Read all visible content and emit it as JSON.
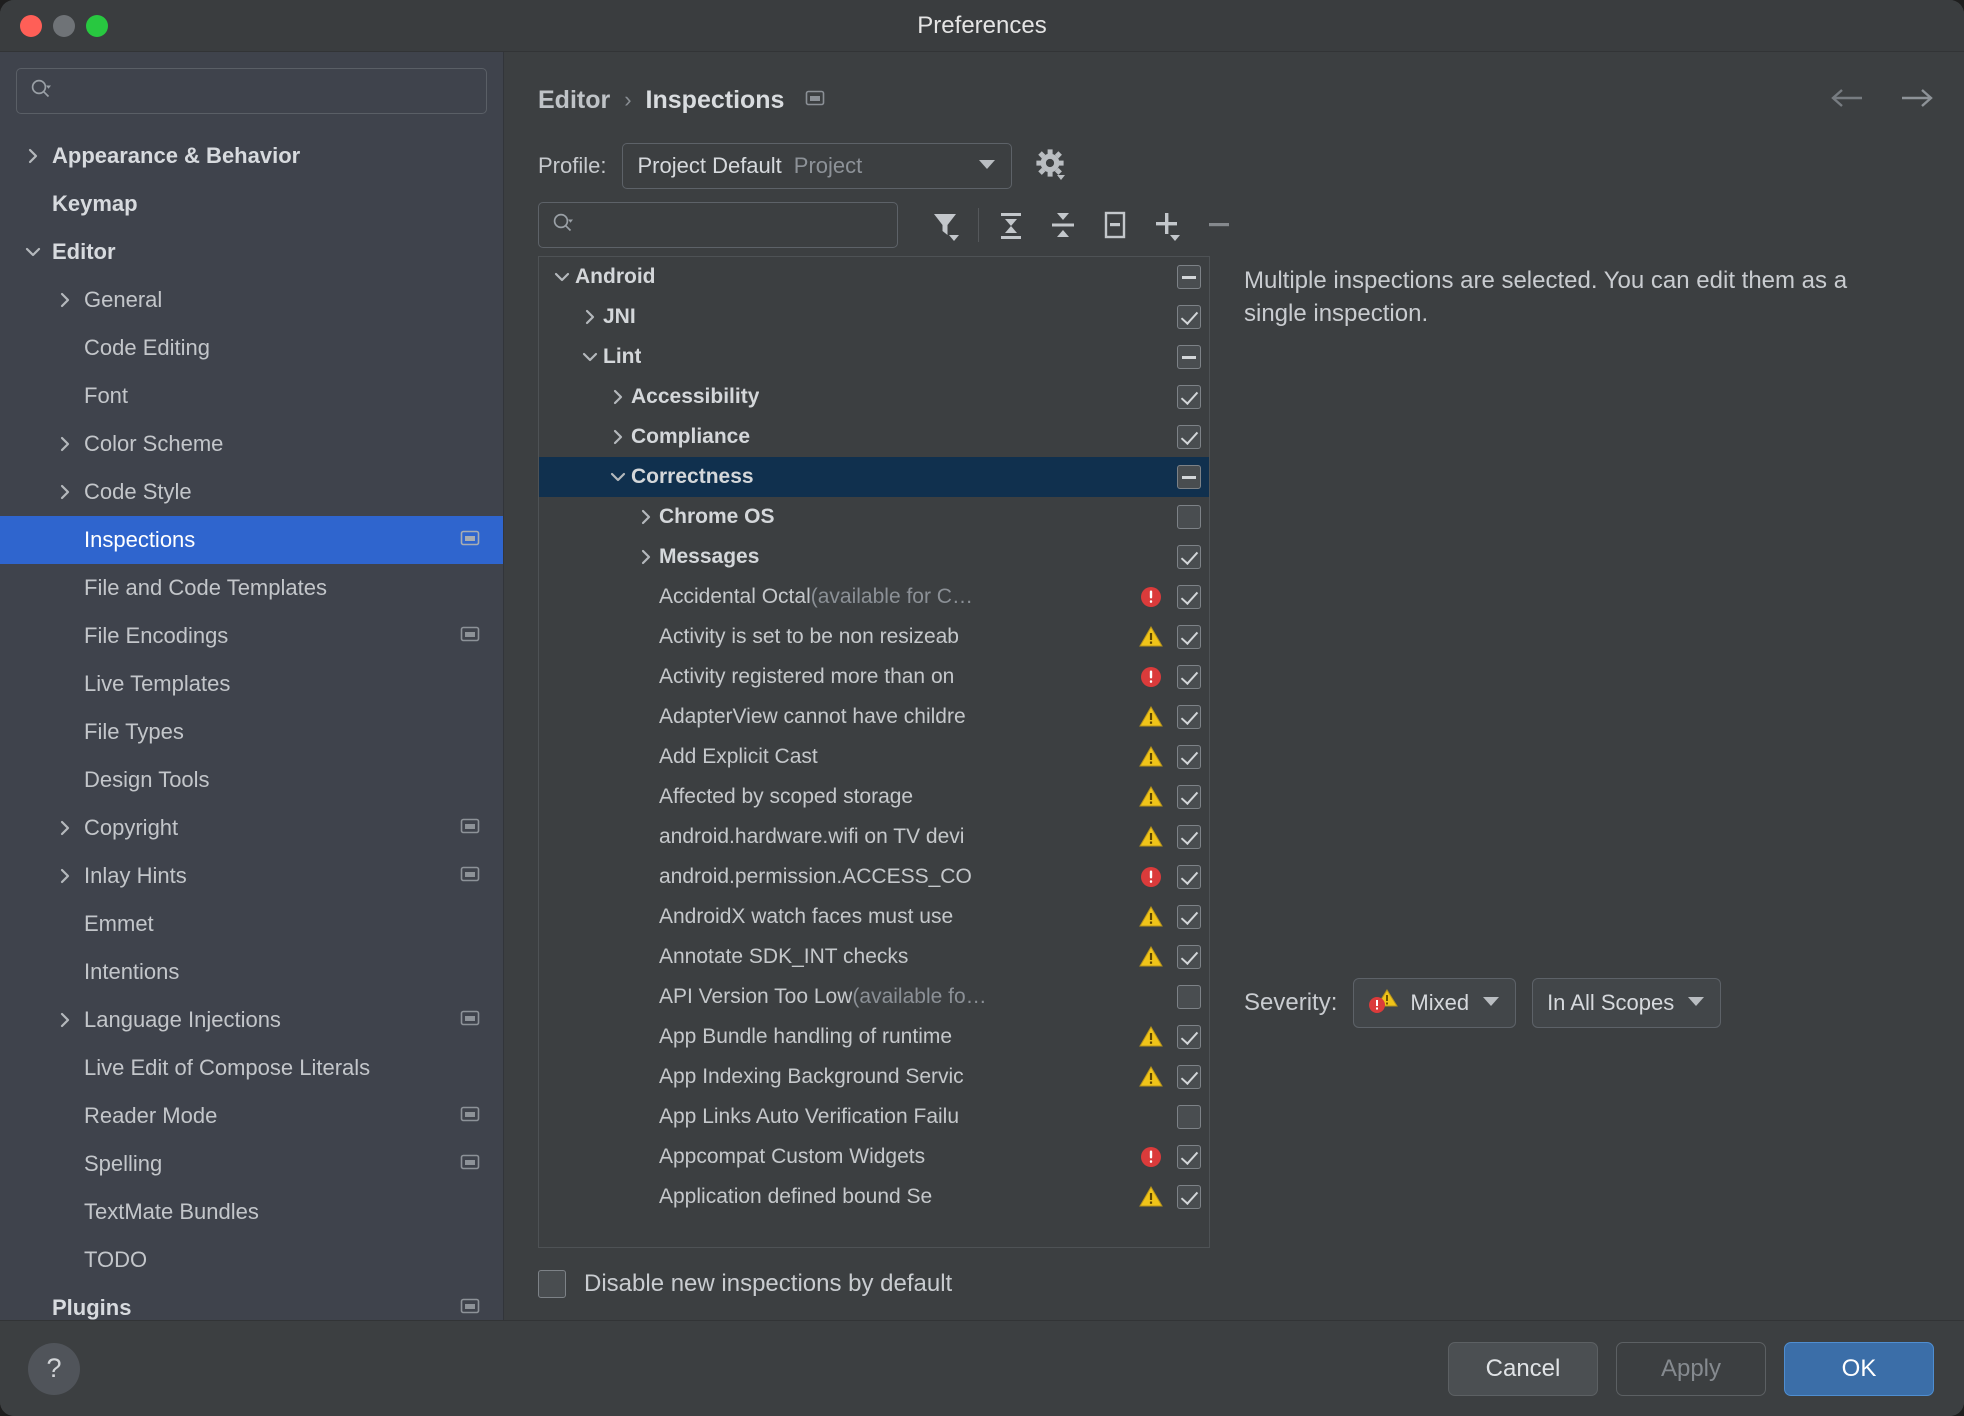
{
  "window": {
    "title": "Preferences"
  },
  "sidebar": {
    "search_placeholder": "",
    "search_value": "",
    "items": [
      {
        "label": "Appearance & Behavior",
        "arrow": "collapsed",
        "bold": true,
        "indent": 0,
        "badge": false,
        "selected": false
      },
      {
        "label": "Keymap",
        "arrow": "none",
        "bold": true,
        "indent": 0,
        "badge": false,
        "selected": false
      },
      {
        "label": "Editor",
        "arrow": "expanded",
        "bold": true,
        "indent": 0,
        "badge": false,
        "selected": false
      },
      {
        "label": "General",
        "arrow": "collapsed",
        "bold": false,
        "indent": 1,
        "badge": false,
        "selected": false
      },
      {
        "label": "Code Editing",
        "arrow": "none",
        "bold": false,
        "indent": 1,
        "badge": false,
        "selected": false
      },
      {
        "label": "Font",
        "arrow": "none",
        "bold": false,
        "indent": 1,
        "badge": false,
        "selected": false
      },
      {
        "label": "Color Scheme",
        "arrow": "collapsed",
        "bold": false,
        "indent": 1,
        "badge": false,
        "selected": false
      },
      {
        "label": "Code Style",
        "arrow": "collapsed",
        "bold": false,
        "indent": 1,
        "badge": false,
        "selected": false
      },
      {
        "label": "Inspections",
        "arrow": "none",
        "bold": false,
        "indent": 1,
        "badge": true,
        "selected": true
      },
      {
        "label": "File and Code Templates",
        "arrow": "none",
        "bold": false,
        "indent": 1,
        "badge": false,
        "selected": false
      },
      {
        "label": "File Encodings",
        "arrow": "none",
        "bold": false,
        "indent": 1,
        "badge": true,
        "selected": false
      },
      {
        "label": "Live Templates",
        "arrow": "none",
        "bold": false,
        "indent": 1,
        "badge": false,
        "selected": false
      },
      {
        "label": "File Types",
        "arrow": "none",
        "bold": false,
        "indent": 1,
        "badge": false,
        "selected": false
      },
      {
        "label": "Design Tools",
        "arrow": "none",
        "bold": false,
        "indent": 1,
        "badge": false,
        "selected": false
      },
      {
        "label": "Copyright",
        "arrow": "collapsed",
        "bold": false,
        "indent": 1,
        "badge": true,
        "selected": false
      },
      {
        "label": "Inlay Hints",
        "arrow": "collapsed",
        "bold": false,
        "indent": 1,
        "badge": true,
        "selected": false
      },
      {
        "label": "Emmet",
        "arrow": "none",
        "bold": false,
        "indent": 1,
        "badge": false,
        "selected": false
      },
      {
        "label": "Intentions",
        "arrow": "none",
        "bold": false,
        "indent": 1,
        "badge": false,
        "selected": false
      },
      {
        "label": "Language Injections",
        "arrow": "collapsed",
        "bold": false,
        "indent": 1,
        "badge": true,
        "selected": false
      },
      {
        "label": "Live Edit of Compose Literals",
        "arrow": "none",
        "bold": false,
        "indent": 1,
        "badge": false,
        "selected": false
      },
      {
        "label": "Reader Mode",
        "arrow": "none",
        "bold": false,
        "indent": 1,
        "badge": true,
        "selected": false
      },
      {
        "label": "Spelling",
        "arrow": "none",
        "bold": false,
        "indent": 1,
        "badge": true,
        "selected": false
      },
      {
        "label": "TextMate Bundles",
        "arrow": "none",
        "bold": false,
        "indent": 1,
        "badge": false,
        "selected": false
      },
      {
        "label": "TODO",
        "arrow": "none",
        "bold": false,
        "indent": 1,
        "badge": false,
        "selected": false
      },
      {
        "label": "Plugins",
        "arrow": "none",
        "bold": true,
        "indent": 0,
        "badge": true,
        "selected": false
      }
    ]
  },
  "breadcrumb": {
    "root": "Editor",
    "separator": "›",
    "current": "Inspections"
  },
  "profile": {
    "label": "Profile:",
    "selected": "Project Default",
    "scope": "Project",
    "gear_icon": "gear-icon"
  },
  "toolbar": {
    "search_value": "",
    "search_placeholder": "",
    "buttons": [
      {
        "name": "filter-icon",
        "title": "Filter"
      },
      {
        "name": "expand-all-icon",
        "title": "Expand All"
      },
      {
        "name": "collapse-all-icon",
        "title": "Collapse All"
      },
      {
        "name": "reset-icon",
        "title": "Reset"
      },
      {
        "name": "add-icon",
        "title": "Add"
      },
      {
        "name": "remove-icon",
        "title": "Remove"
      }
    ]
  },
  "inspection_tree": {
    "rows": [
      {
        "label": "Android",
        "suffix": "",
        "indent": 0,
        "twisty": "expanded",
        "group": true,
        "state": "partial",
        "severity": "none",
        "selected": false
      },
      {
        "label": "JNI",
        "suffix": "",
        "indent": 1,
        "twisty": "collapsed",
        "group": true,
        "state": "checked",
        "severity": "none",
        "selected": false
      },
      {
        "label": "Lint",
        "suffix": "",
        "indent": 1,
        "twisty": "expanded",
        "group": true,
        "state": "partial",
        "severity": "none",
        "selected": false
      },
      {
        "label": "Accessibility",
        "suffix": "",
        "indent": 2,
        "twisty": "collapsed",
        "group": true,
        "state": "checked",
        "severity": "none",
        "selected": false
      },
      {
        "label": "Compliance",
        "suffix": "",
        "indent": 2,
        "twisty": "collapsed",
        "group": true,
        "state": "checked",
        "severity": "none",
        "selected": false
      },
      {
        "label": "Correctness",
        "suffix": "",
        "indent": 2,
        "twisty": "expanded",
        "group": true,
        "state": "partial",
        "severity": "none",
        "selected": true
      },
      {
        "label": "Chrome OS",
        "suffix": "",
        "indent": 3,
        "twisty": "collapsed",
        "group": true,
        "state": "unchecked",
        "severity": "none",
        "selected": false
      },
      {
        "label": "Messages",
        "suffix": "",
        "indent": 3,
        "twisty": "collapsed",
        "group": true,
        "state": "checked",
        "severity": "none",
        "selected": false
      },
      {
        "label": "Accidental Octal",
        "suffix": " (available for C…",
        "indent": 3,
        "twisty": "none",
        "group": false,
        "state": "checked",
        "severity": "error",
        "selected": false
      },
      {
        "label": "Activity is set to be non resizeab",
        "suffix": "",
        "indent": 3,
        "twisty": "none",
        "group": false,
        "state": "checked",
        "severity": "warning",
        "selected": false
      },
      {
        "label": "Activity registered more than on",
        "suffix": "",
        "indent": 3,
        "twisty": "none",
        "group": false,
        "state": "checked",
        "severity": "error",
        "selected": false
      },
      {
        "label": "AdapterView cannot have childre",
        "suffix": "",
        "indent": 3,
        "twisty": "none",
        "group": false,
        "state": "checked",
        "severity": "warning",
        "selected": false
      },
      {
        "label": "Add Explicit Cast",
        "suffix": "",
        "indent": 3,
        "twisty": "none",
        "group": false,
        "state": "checked",
        "severity": "warning",
        "selected": false
      },
      {
        "label": "Affected by scoped storage",
        "suffix": "",
        "indent": 3,
        "twisty": "none",
        "group": false,
        "state": "checked",
        "severity": "warning",
        "selected": false
      },
      {
        "label": "android.hardware.wifi on TV devi",
        "suffix": "",
        "indent": 3,
        "twisty": "none",
        "group": false,
        "state": "checked",
        "severity": "warning",
        "selected": false
      },
      {
        "label": "android.permission.ACCESS_CO",
        "suffix": "",
        "indent": 3,
        "twisty": "none",
        "group": false,
        "state": "checked",
        "severity": "error",
        "selected": false
      },
      {
        "label": "AndroidX watch faces must use ",
        "suffix": "",
        "indent": 3,
        "twisty": "none",
        "group": false,
        "state": "checked",
        "severity": "warning",
        "selected": false
      },
      {
        "label": "Annotate SDK_INT checks",
        "suffix": "",
        "indent": 3,
        "twisty": "none",
        "group": false,
        "state": "checked",
        "severity": "warning",
        "selected": false
      },
      {
        "label": "API Version Too Low",
        "suffix": " (available fo…",
        "indent": 3,
        "twisty": "none",
        "group": false,
        "state": "unchecked",
        "severity": "none",
        "selected": false
      },
      {
        "label": "App Bundle handling of runtime ",
        "suffix": "",
        "indent": 3,
        "twisty": "none",
        "group": false,
        "state": "checked",
        "severity": "warning",
        "selected": false
      },
      {
        "label": "App Indexing Background Servic",
        "suffix": "",
        "indent": 3,
        "twisty": "none",
        "group": false,
        "state": "checked",
        "severity": "warning",
        "selected": false
      },
      {
        "label": "App Links Auto Verification Failu",
        "suffix": "",
        "indent": 3,
        "twisty": "none",
        "group": false,
        "state": "unchecked",
        "severity": "none",
        "selected": false
      },
      {
        "label": "Appcompat Custom Widgets",
        "suffix": "",
        "indent": 3,
        "twisty": "none",
        "group": false,
        "state": "checked",
        "severity": "error",
        "selected": false
      },
      {
        "label": "Application defined bound Se",
        "suffix": "",
        "indent": 3,
        "twisty": "none",
        "group": false,
        "state": "checked",
        "severity": "warning",
        "selected": false
      }
    ]
  },
  "detail": {
    "message": "Multiple inspections are selected. You can edit them as a single inspection.",
    "severity_label": "Severity:",
    "severity_value": "Mixed",
    "scope_value": "In All Scopes"
  },
  "disable_new": {
    "label": "Disable new inspections by default",
    "checked": false
  },
  "footer": {
    "help_glyph": "?",
    "cancel": "Cancel",
    "apply": "Apply",
    "ok": "OK"
  },
  "colors": {
    "accent_selected": "#2f65ce",
    "tree_selected": "#10304e",
    "ok_button": "#3b6ea8",
    "error": "#db3b3b",
    "warning": "#f0c419",
    "sidebar_bg": "#3f434c",
    "panel_bg": "#3c3f41"
  }
}
